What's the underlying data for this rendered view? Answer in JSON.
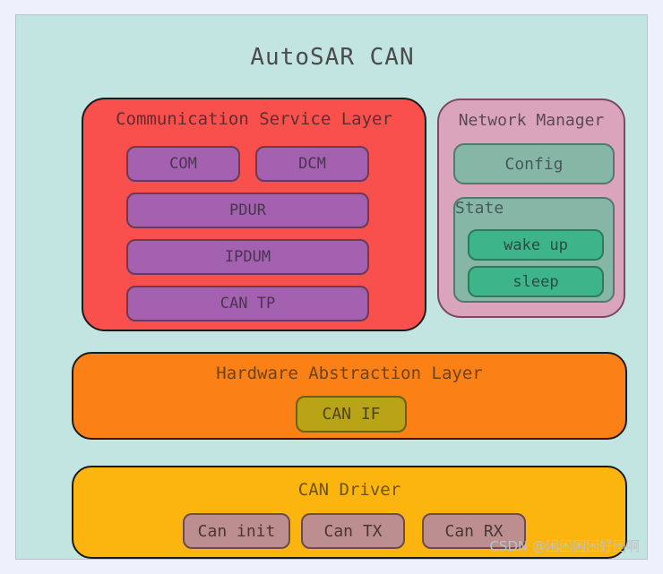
{
  "diagram": {
    "title": "AutoSAR CAN",
    "background_color": "#c3e5e1",
    "page_color": "#eef1fb",
    "watermark": "CSDN @困困困困好困啊"
  },
  "layers": {
    "communication_service": {
      "title": "Communication Service Layer",
      "color": "#f9504e",
      "items": [
        {
          "label": "COM"
        },
        {
          "label": "DCM"
        },
        {
          "label": "PDUR"
        },
        {
          "label": "IPDUM"
        },
        {
          "label": "CAN TP"
        }
      ],
      "item_color": "#a361b0"
    },
    "network_manager": {
      "title": "Network Manager",
      "color": "#dba4bd",
      "config": {
        "label": "Config",
        "color": "#86b7a6"
      },
      "state": {
        "label": "State",
        "color": "#86b7a6",
        "items": [
          {
            "label": "wake up"
          },
          {
            "label": "sleep"
          }
        ],
        "item_color": "#3db489"
      }
    },
    "hardware_abstraction": {
      "title": "Hardware Abstraction Layer",
      "color": "#fb8015",
      "items": [
        {
          "label": "CAN IF"
        }
      ],
      "item_color": "#b9a316"
    },
    "can_driver": {
      "title": "CAN Driver",
      "color": "#fcb40f",
      "items": [
        {
          "label": "Can init"
        },
        {
          "label": "Can TX"
        },
        {
          "label": "Can RX"
        }
      ],
      "item_color": "#bd8e8e"
    }
  }
}
